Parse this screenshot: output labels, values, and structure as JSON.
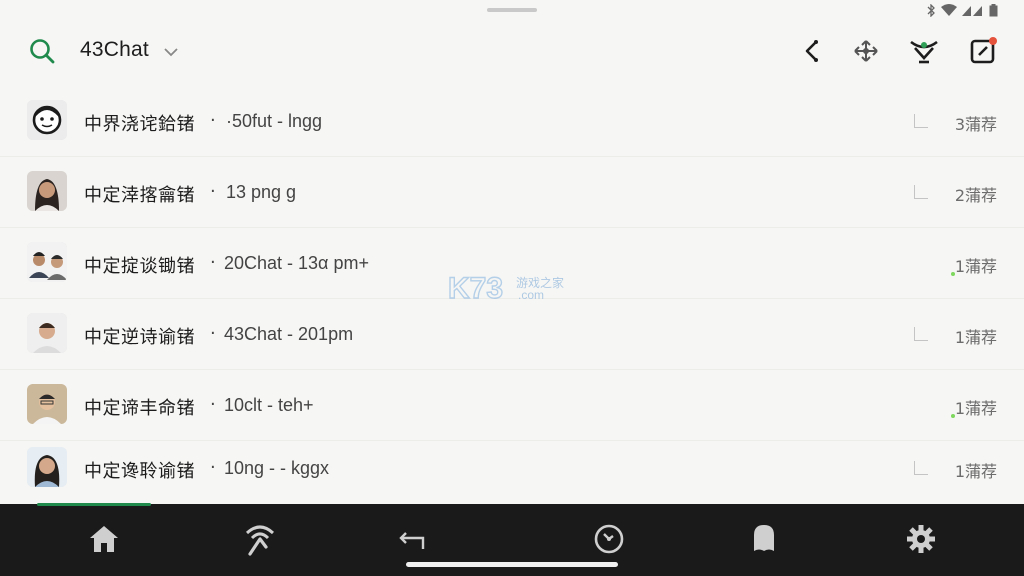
{
  "header": {
    "title": "43Chat"
  },
  "chats": [
    {
      "name": "中界浇诧鉿锗",
      "sep": "·",
      "meta": "·50fut - lngg",
      "recommend": "3蒲荐"
    },
    {
      "name": "中定涬揢龠锗",
      "sep": "·",
      "meta": "13 png g",
      "recommend": "2蒲荐"
    },
    {
      "name": "中定掟谈锄锗",
      "sep": "·",
      "meta": "20Chat - 13α pm+",
      "recommend": "1蒲荐"
    },
    {
      "name": "中定逆诗谕锗",
      "sep": "·",
      "meta": "43Chat - 201pm",
      "recommend": "1蒲荐"
    },
    {
      "name": "中定谛丰命锗",
      "sep": "·",
      "meta": "10clt - teh+",
      "recommend": "1蒲荐"
    },
    {
      "name": "中定谗聆谕锗",
      "sep": "·",
      "meta": "10ng - - kggx",
      "recommend": "1蒲荐"
    }
  ],
  "watermark": {
    "brand": "K73",
    "sub": "游戏之家",
    "domain": ".com"
  },
  "icons": {
    "search": "search-icon",
    "back": "share-back-icon",
    "move": "move-icon",
    "filter": "filter-funnel-icon",
    "compose": "compose-icon",
    "nav_home": "home-icon",
    "nav_discover": "wifi-antenna-icon",
    "nav_reply": "reply-icon",
    "nav_clock": "clock-icon",
    "nav_profile": "person-icon",
    "nav_settings": "gear-icon"
  },
  "colors": {
    "accent": "#1f8a4c",
    "nav_bg": "#1a1a1a",
    "notification": "#e5533d"
  }
}
